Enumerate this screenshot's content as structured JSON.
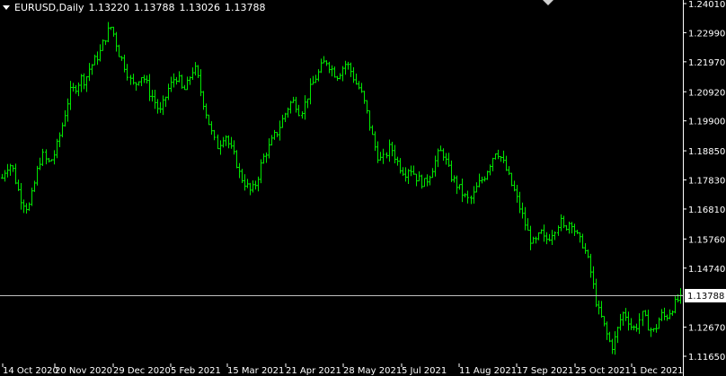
{
  "symbol_label": "EURUSD,Daily",
  "ohlc": {
    "open": "1.13220",
    "high": "1.13788",
    "low": "1.13026",
    "close": "1.13788"
  },
  "current_price_label": "1.13788",
  "colors": {
    "background": "#000000",
    "bars": "#00e600",
    "axis": "#ffffff",
    "price_line": "#c0c0c0"
  },
  "chart_data": {
    "type": "ohlc",
    "title": "EURUSD,Daily",
    "y_axis": {
      "ticks": [
        "1.24010",
        "1.22990",
        "1.21970",
        "1.20920",
        "1.19900",
        "1.18850",
        "1.17830",
        "1.16810",
        "1.15760",
        "1.14740",
        "1.13788",
        "1.12670",
        "1.11650"
      ],
      "ylim": [
        1.1155,
        1.2415
      ]
    },
    "x_axis": {
      "ticks": [
        "14 Oct 2020",
        "20 Nov 2020",
        "29 Dec 2020",
        "5 Feb 2021",
        "15 Mar 2021",
        "21 Apr 2021",
        "28 May 2021",
        "5 Jul 2021",
        "11 Aug 2021",
        "17 Sep 2021",
        "25 Oct 2021",
        "1 Dec 2021"
      ]
    },
    "last_price": 1.13788,
    "close_path": [
      1.179,
      1.1825,
      1.184,
      1.1815,
      1.176,
      1.172,
      1.17,
      1.168,
      1.173,
      1.179,
      1.185,
      1.187,
      1.184,
      1.1855,
      1.188,
      1.193,
      1.198,
      1.204,
      1.209,
      1.21,
      1.212,
      1.214,
      1.213,
      1.217,
      1.219,
      1.221,
      1.223,
      1.227,
      1.23,
      1.232,
      1.228,
      1.223,
      1.22,
      1.217,
      1.213,
      1.211,
      1.214,
      1.215,
      1.213,
      1.209,
      1.207,
      1.204,
      1.202,
      1.206,
      1.21,
      1.212,
      1.215,
      1.213,
      1.209,
      1.211,
      1.215,
      1.218,
      1.214,
      1.208,
      1.203,
      1.198,
      1.193,
      1.19,
      1.192,
      1.195,
      1.191,
      1.188,
      1.185,
      1.18,
      1.178,
      1.176,
      1.174,
      1.176,
      1.18,
      1.185,
      1.188,
      1.19,
      1.193,
      1.195,
      1.198,
      1.201,
      1.204,
      1.206,
      1.205,
      1.202,
      1.204,
      1.208,
      1.211,
      1.214,
      1.216,
      1.219,
      1.22,
      1.218,
      1.216,
      1.215,
      1.217,
      1.219,
      1.218,
      1.215,
      1.212,
      1.21,
      1.206,
      1.201,
      1.195,
      1.19,
      1.186,
      1.185,
      1.188,
      1.19,
      1.187,
      1.184,
      1.182,
      1.181,
      1.183,
      1.181,
      1.179,
      1.178,
      1.177,
      1.179,
      1.182,
      1.185,
      1.188,
      1.188,
      1.184,
      1.18,
      1.178,
      1.176,
      1.174,
      1.172,
      1.171,
      1.173,
      1.176,
      1.178,
      1.18,
      1.183,
      1.186,
      1.189,
      1.187,
      1.184,
      1.181,
      1.177,
      1.174,
      1.17,
      1.166,
      1.162,
      1.158,
      1.156,
      1.157,
      1.16,
      1.157,
      1.158,
      1.16,
      1.162,
      1.164,
      1.161,
      1.163,
      1.164,
      1.16,
      1.157,
      1.156,
      1.152,
      1.147,
      1.14,
      1.133,
      1.13,
      1.126,
      1.122,
      1.12,
      1.124,
      1.129,
      1.132,
      1.13,
      1.127,
      1.126,
      1.129,
      1.131,
      1.128,
      1.126,
      1.125,
      1.129,
      1.131,
      1.13,
      1.132,
      1.134,
      1.1355,
      1.1379
    ]
  }
}
